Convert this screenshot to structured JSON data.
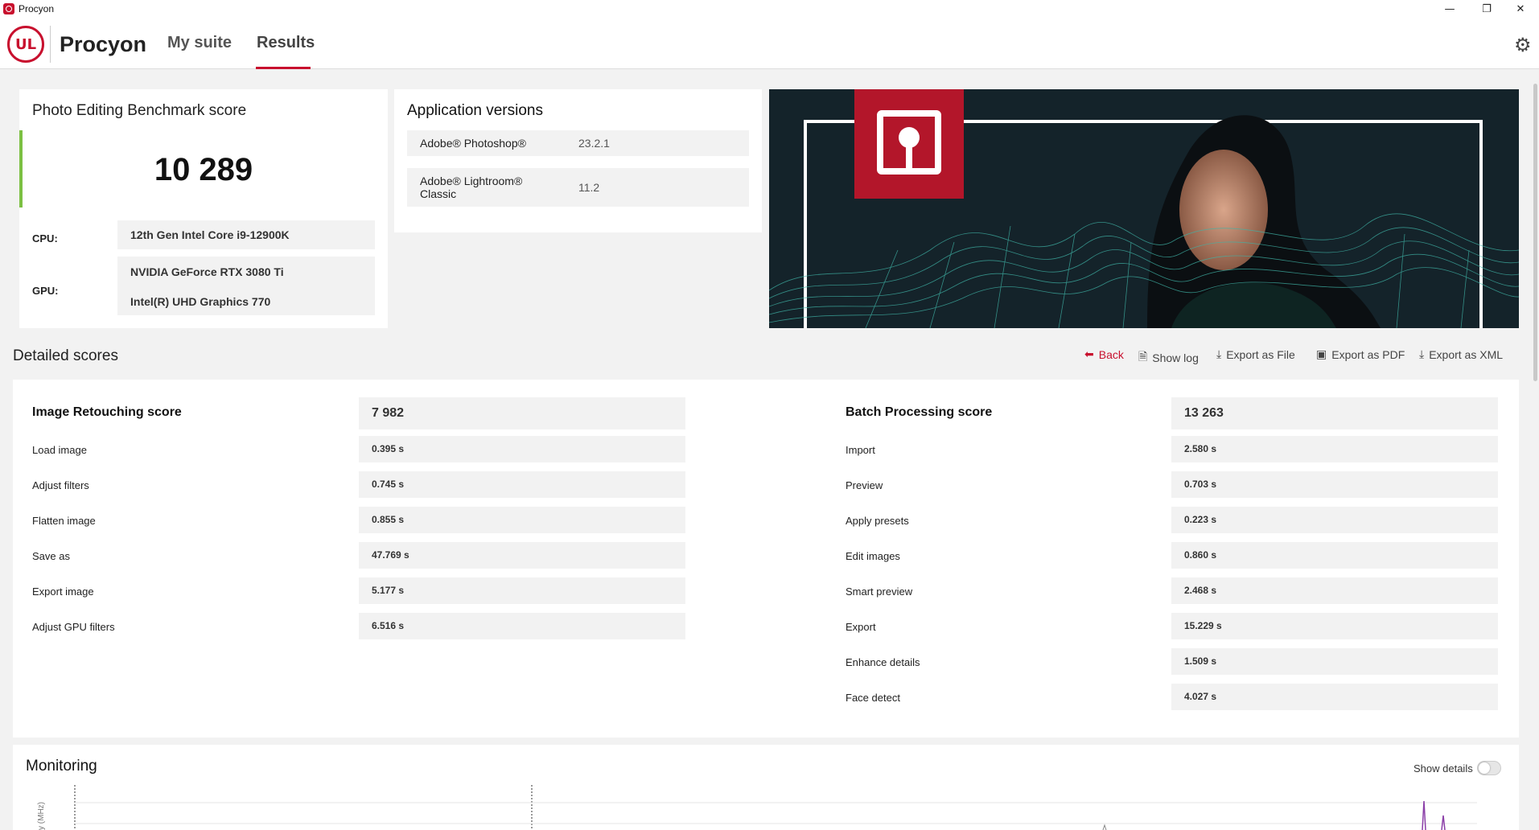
{
  "window": {
    "title": "Procyon",
    "minimize_glyph": "—",
    "restore_glyph": "❐",
    "close_glyph": "✕"
  },
  "header": {
    "logo_text": "UL",
    "brand": "Procyon",
    "nav": [
      {
        "label": "My suite"
      },
      {
        "label": "Results"
      }
    ],
    "settings_icon": "gear-icon"
  },
  "score_card": {
    "title": "Photo Editing Benchmark score",
    "score": "10 289",
    "status_color": "#7cc043",
    "cpu_label": "CPU:",
    "cpu_value": "12th Gen Intel Core i9-12900K",
    "gpu_label": "GPU:",
    "gpu_values": [
      "NVIDIA GeForce RTX 3080 Ti",
      "Intel(R) UHD Graphics 770"
    ]
  },
  "app_versions": {
    "title": "Application versions",
    "apps": [
      {
        "name": "Adobe® Photoshop®",
        "version": "23.2.1"
      },
      {
        "name_line1": "Adobe® Lightroom®",
        "name_line2": "Classic",
        "version": "11.2"
      }
    ]
  },
  "detailed": {
    "title": "Detailed scores",
    "actions": {
      "back": "Back",
      "show_log": "Show log",
      "export_file": "Export as File",
      "export_pdf": "Export as PDF",
      "export_xml": "Export as XML"
    },
    "left": {
      "title": "Image Retouching score",
      "score": "7 982",
      "rows": [
        {
          "label": "Load image",
          "value": "0.395 s"
        },
        {
          "label": "Adjust filters",
          "value": "0.745 s"
        },
        {
          "label": "Flatten image",
          "value": "0.855 s"
        },
        {
          "label": "Save as",
          "value": "47.769 s"
        },
        {
          "label": "Export image",
          "value": "5.177 s"
        },
        {
          "label": "Adjust GPU filters",
          "value": "6.516 s"
        }
      ]
    },
    "right": {
      "title": "Batch Processing score",
      "score": "13 263",
      "rows": [
        {
          "label": "Import",
          "value": "2.580 s"
        },
        {
          "label": "Preview",
          "value": "0.703 s"
        },
        {
          "label": "Apply presets",
          "value": "0.223 s"
        },
        {
          "label": "Edit images",
          "value": "0.860 s"
        },
        {
          "label": "Smart preview",
          "value": "2.468 s"
        },
        {
          "label": "Export",
          "value": "15.229 s"
        },
        {
          "label": "Enhance details",
          "value": "1.509 s"
        },
        {
          "label": "Face detect",
          "value": "4.027 s"
        }
      ]
    }
  },
  "monitoring": {
    "title": "Monitoring",
    "show_details_label": "Show details",
    "show_details_on": false,
    "axis_label_fragment": "y (MHz)"
  },
  "colors": {
    "accent": "#c8102e",
    "score_bar": "#7cc043"
  }
}
